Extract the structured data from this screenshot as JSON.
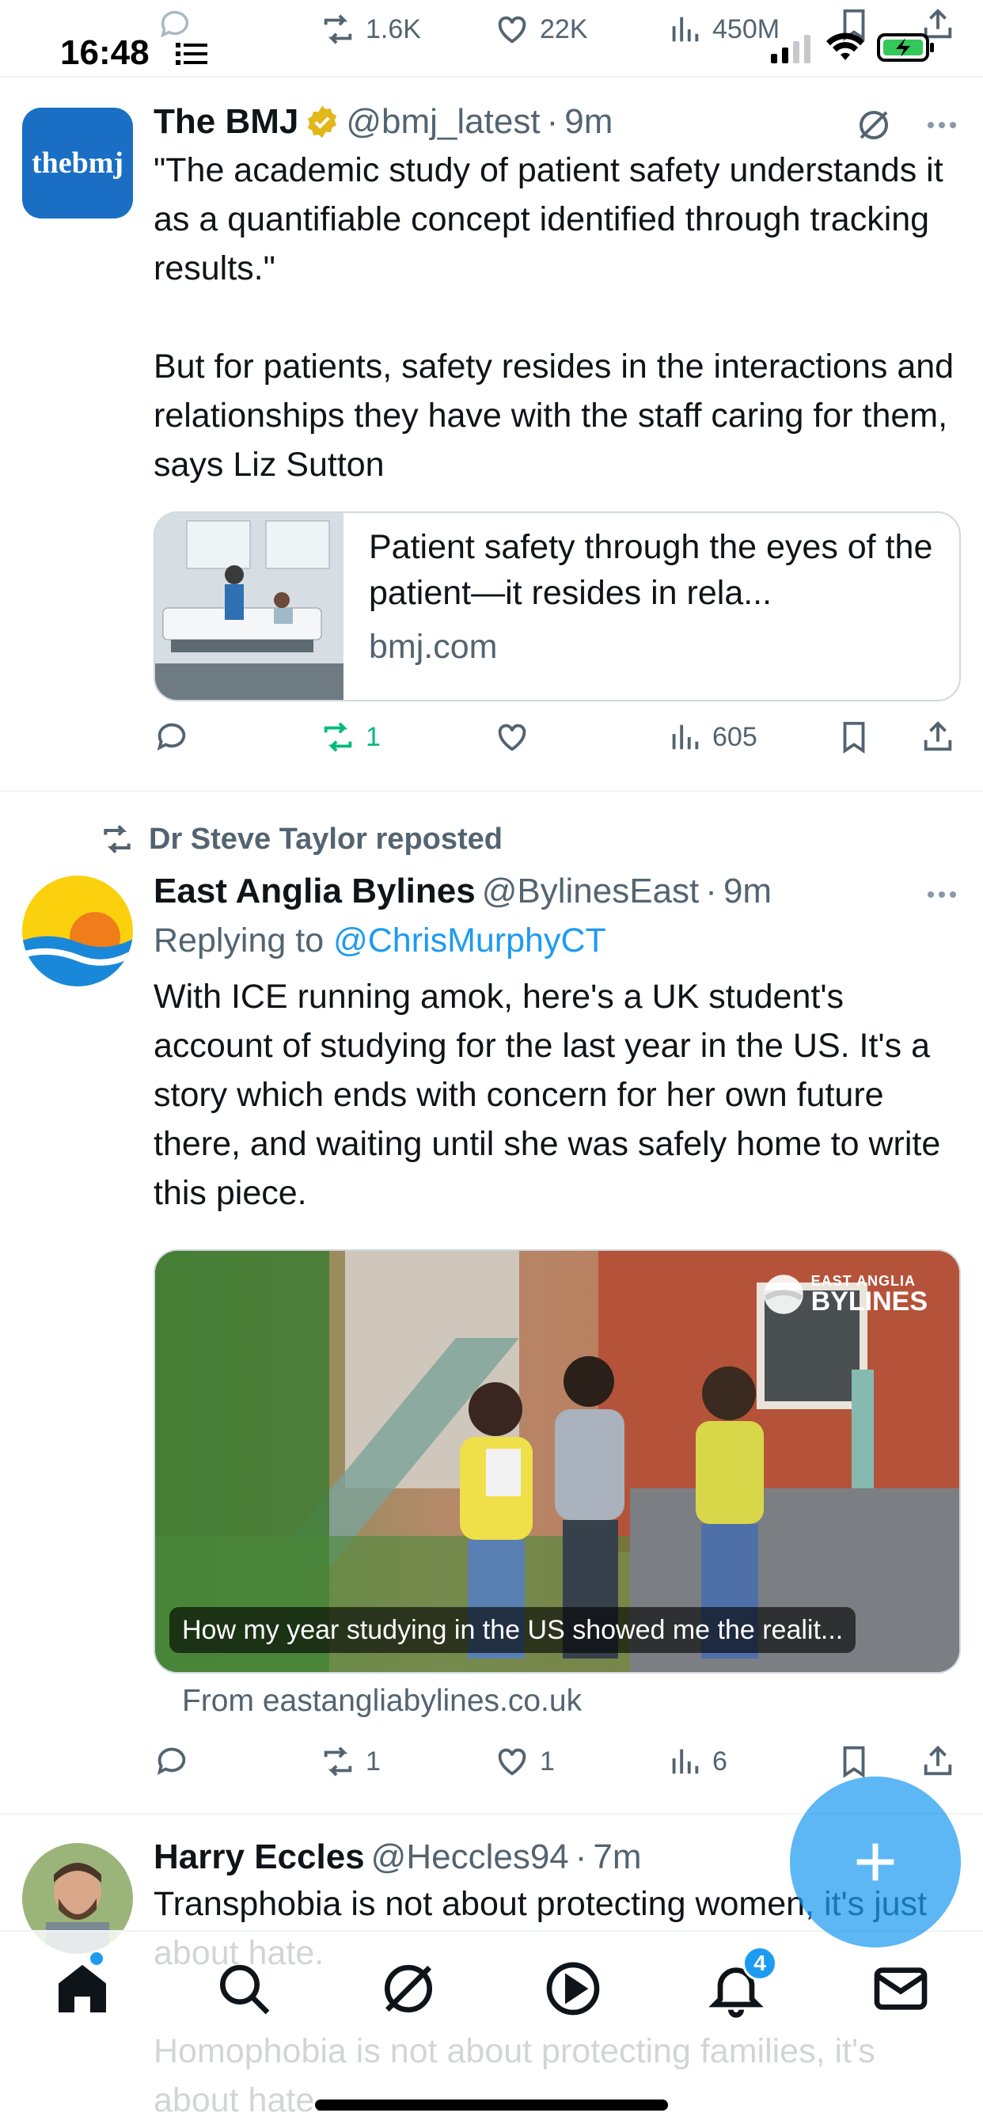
{
  "status_bar": {
    "time": "16:48"
  },
  "top_actions": {
    "reposts": "1.6K",
    "likes": "22K",
    "views": "450M"
  },
  "tweets": [
    {
      "avatar_text": "thebmj",
      "name": "The BMJ",
      "verified": true,
      "handle": "@bmj_latest",
      "sep": "·",
      "time": "9m",
      "text": "\"The academic study of patient safety understands it as a quantifiable concept identified through tracking results.\"\n\nBut for patients, safety resides in the interactions and relationships they have with the staff caring for them, says Liz Sutton",
      "card": {
        "title": "Patient safety through the eyes of the patient—it resides in rela...",
        "domain": "bmj.com"
      },
      "stats": {
        "replies": "",
        "reposts": "1",
        "likes": "",
        "views": "605"
      }
    },
    {
      "reposted_by": "Dr Steve Taylor reposted",
      "name": "East Anglia Bylines",
      "handle": "@BylinesEast",
      "sep": "·",
      "time": "9m",
      "replying_prefix": "Replying to ",
      "replying_to": "@ChrisMurphyCT",
      "text": "With ICE running amok, here's a UK student's account of studying for the last year in the US. It's a story which ends with concern for her own future there, and waiting until she was safely home to write this piece.",
      "card": {
        "logo_line1": "EAST ANGLIA",
        "logo_line2": "BYLINES",
        "caption": "How my year studying in the US showed me the realit...",
        "from": "From eastangliabylines.co.uk"
      },
      "stats": {
        "replies": "",
        "reposts": "1",
        "likes": "1",
        "views": "6"
      }
    },
    {
      "name": "Harry Eccles",
      "handle": "@Heccles94",
      "sep": "·",
      "time": "7m",
      "text": "Transphobia is not about protecting women, it's just about hate.\n\nHomophobia is not about protecting families, it's about hate."
    }
  ],
  "tabbar": {
    "notifications_badge": "4"
  },
  "colors": {
    "accent": "#1d9bf0",
    "repost_active": "#00ba7c",
    "muted": "#536471"
  }
}
